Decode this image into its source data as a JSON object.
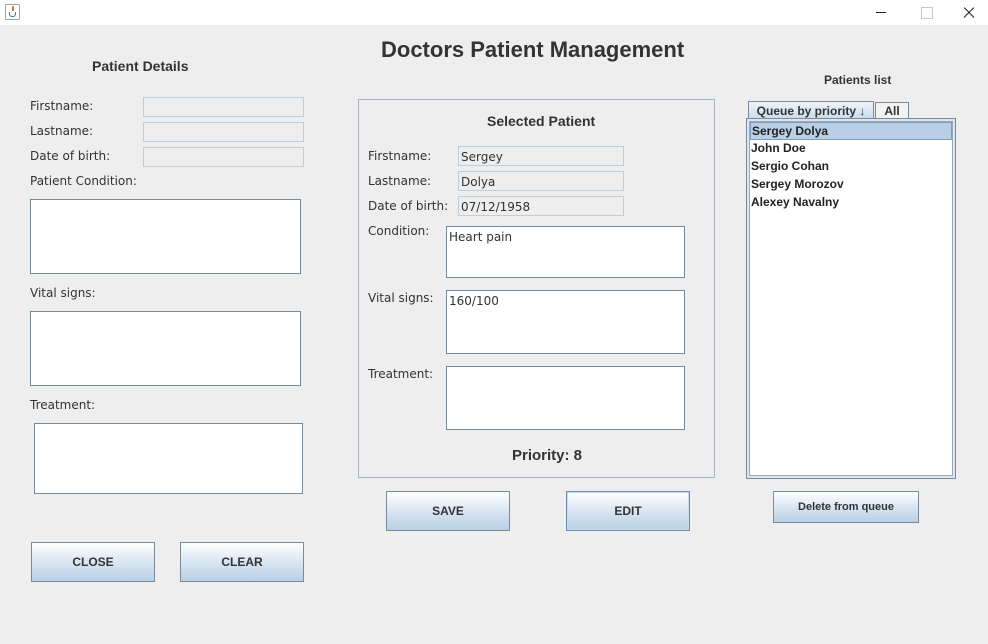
{
  "window": {
    "title": ""
  },
  "app_title": "Doctors Patient Management",
  "patient_details": {
    "title": "Patient Details",
    "firstname_label": "Firstname:",
    "lastname_label": "Lastname:",
    "dob_label": "Date of birth:",
    "condition_label": "Patient Condition:",
    "vital_signs_label": "Vital signs:",
    "treatment_label": "Treatment:",
    "close_label": "CLOSE",
    "clear_label": "CLEAR"
  },
  "selected_patient": {
    "title": "Selected Patient",
    "firstname_label": "Firstname:",
    "firstname_value": "Sergey",
    "lastname_label": "Lastname:",
    "lastname_value": "Dolya",
    "dob_label": "Date of birth:",
    "dob_value": "07/12/1958",
    "condition_label": "Condition:",
    "condition_value": "Heart pain",
    "vital_signs_label": "Vital signs:",
    "vital_signs_value": "160/100",
    "treatment_label": "Treatment:",
    "treatment_value": "",
    "priority_text": "Priority: 8",
    "save_label": "SAVE",
    "edit_label": "EDIT"
  },
  "patients_list": {
    "title": "Patients list",
    "tabs": [
      "Queue by priority ↓",
      "All"
    ],
    "items": [
      "Sergey Dolya",
      "John Doe",
      "Sergio Cohan",
      "Sergey Morozov",
      "Alexey Navalny"
    ],
    "selected_index": 0,
    "delete_label": "Delete from queue"
  }
}
